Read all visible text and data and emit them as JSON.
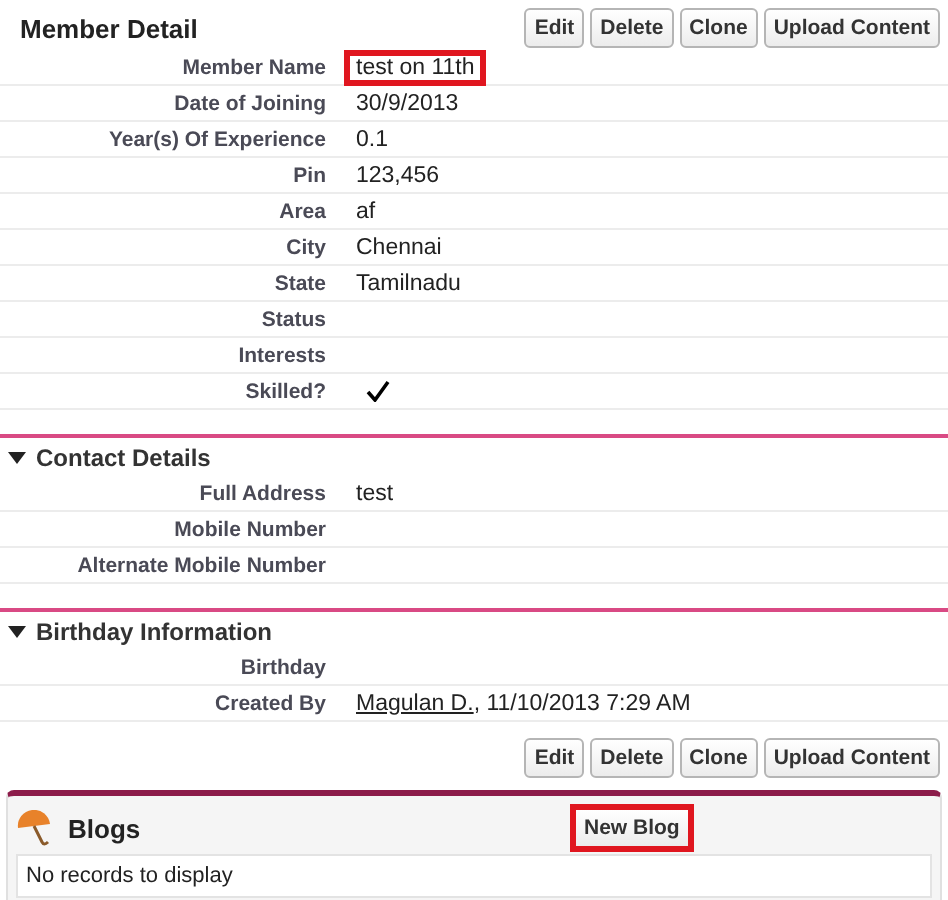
{
  "title": "Member Detail",
  "top_buttons": [
    "Edit",
    "Delete",
    "Clone",
    "Upload Content"
  ],
  "fields": [
    {
      "kind": "text",
      "label": "Member Name",
      "value": "test on 11th",
      "highlighted": true
    },
    {
      "kind": "text",
      "label": "Date of Joining",
      "value": "30/9/2013"
    },
    {
      "kind": "text",
      "label": "Year(s) Of Experience",
      "value": "0.1"
    },
    {
      "kind": "text",
      "label": "Pin",
      "value": "123,456"
    },
    {
      "kind": "text",
      "label": "Area",
      "value": "af"
    },
    {
      "kind": "text",
      "label": "City",
      "value": "Chennai"
    },
    {
      "kind": "text",
      "label": "State",
      "value": "Tamilnadu"
    },
    {
      "kind": "text",
      "label": "Status"
    },
    {
      "kind": "text",
      "label": "Interests"
    },
    {
      "kind": "check",
      "label": "Skilled?",
      "checked": true
    }
  ],
  "sections": [
    {
      "title": "Contact Details",
      "expanded": true,
      "fields": [
        {
          "kind": "text",
          "label": "Full Address",
          "value": "test"
        },
        {
          "kind": "text",
          "label": "Mobile Number"
        },
        {
          "kind": "text",
          "label": "Alternate Mobile Number"
        }
      ]
    },
    {
      "title": "Birthday Information",
      "expanded": true,
      "fields": [
        {
          "kind": "text",
          "label": "Birthday"
        },
        {
          "kind": "link",
          "label": "Created By",
          "link": "Magulan D.",
          "value": ", 11/10/2013 7:29 AM"
        }
      ]
    }
  ],
  "bottom_buttons": [
    "Edit",
    "Delete",
    "Clone",
    "Upload Content"
  ],
  "related": {
    "title": "Blogs",
    "button": {
      "label": "New Blog",
      "highlighted": true
    },
    "empty_text": "No records to display"
  }
}
